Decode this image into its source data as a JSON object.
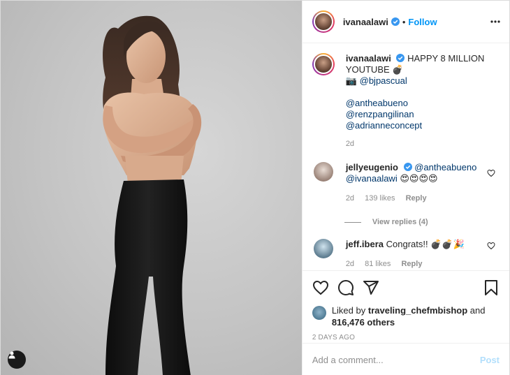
{
  "header": {
    "username": "ivanaalawi",
    "separator": "•",
    "follow_label": "Follow"
  },
  "caption": {
    "username": "ivanaalawi",
    "text_line1": "HAPPY 8 MILLION YOUTUBE 💣",
    "photographer_prefix": "📷",
    "photographer": "@bjpascual",
    "mentions": [
      "@antheabueno",
      "@renzpangilinan",
      "@adrianneconcept"
    ],
    "time": "2d"
  },
  "comments": [
    {
      "username": "jellyeugenio",
      "mention1": "@antheabueno",
      "mention2": "@ivanaalawi",
      "emojis": "😍😍😍😍",
      "time": "2d",
      "likes": "139 likes",
      "reply_label": "Reply",
      "view_replies": "View replies (4)"
    },
    {
      "username": "jeff.ibera",
      "text": "Congrats!! 💣💣🎉",
      "time": "2d",
      "likes": "81 likes",
      "reply_label": "Reply"
    }
  ],
  "likes": {
    "prefix": "Liked by",
    "user": "traveling_chefmbishop",
    "and": "and",
    "count": "816,476 others"
  },
  "date_label": "2 DAYS AGO",
  "comment_input": {
    "placeholder": "Add a comment...",
    "post_label": "Post"
  },
  "icons": {
    "like": "heart-icon",
    "comment": "comment-icon",
    "share": "share-icon",
    "save": "bookmark-icon",
    "more": "more-options-icon",
    "tag": "user-tag-icon"
  },
  "colors": {
    "link_blue": "#0095f6",
    "mention": "#00376b",
    "muted": "#8e8e8e",
    "post_disabled": "#b2dffc"
  }
}
